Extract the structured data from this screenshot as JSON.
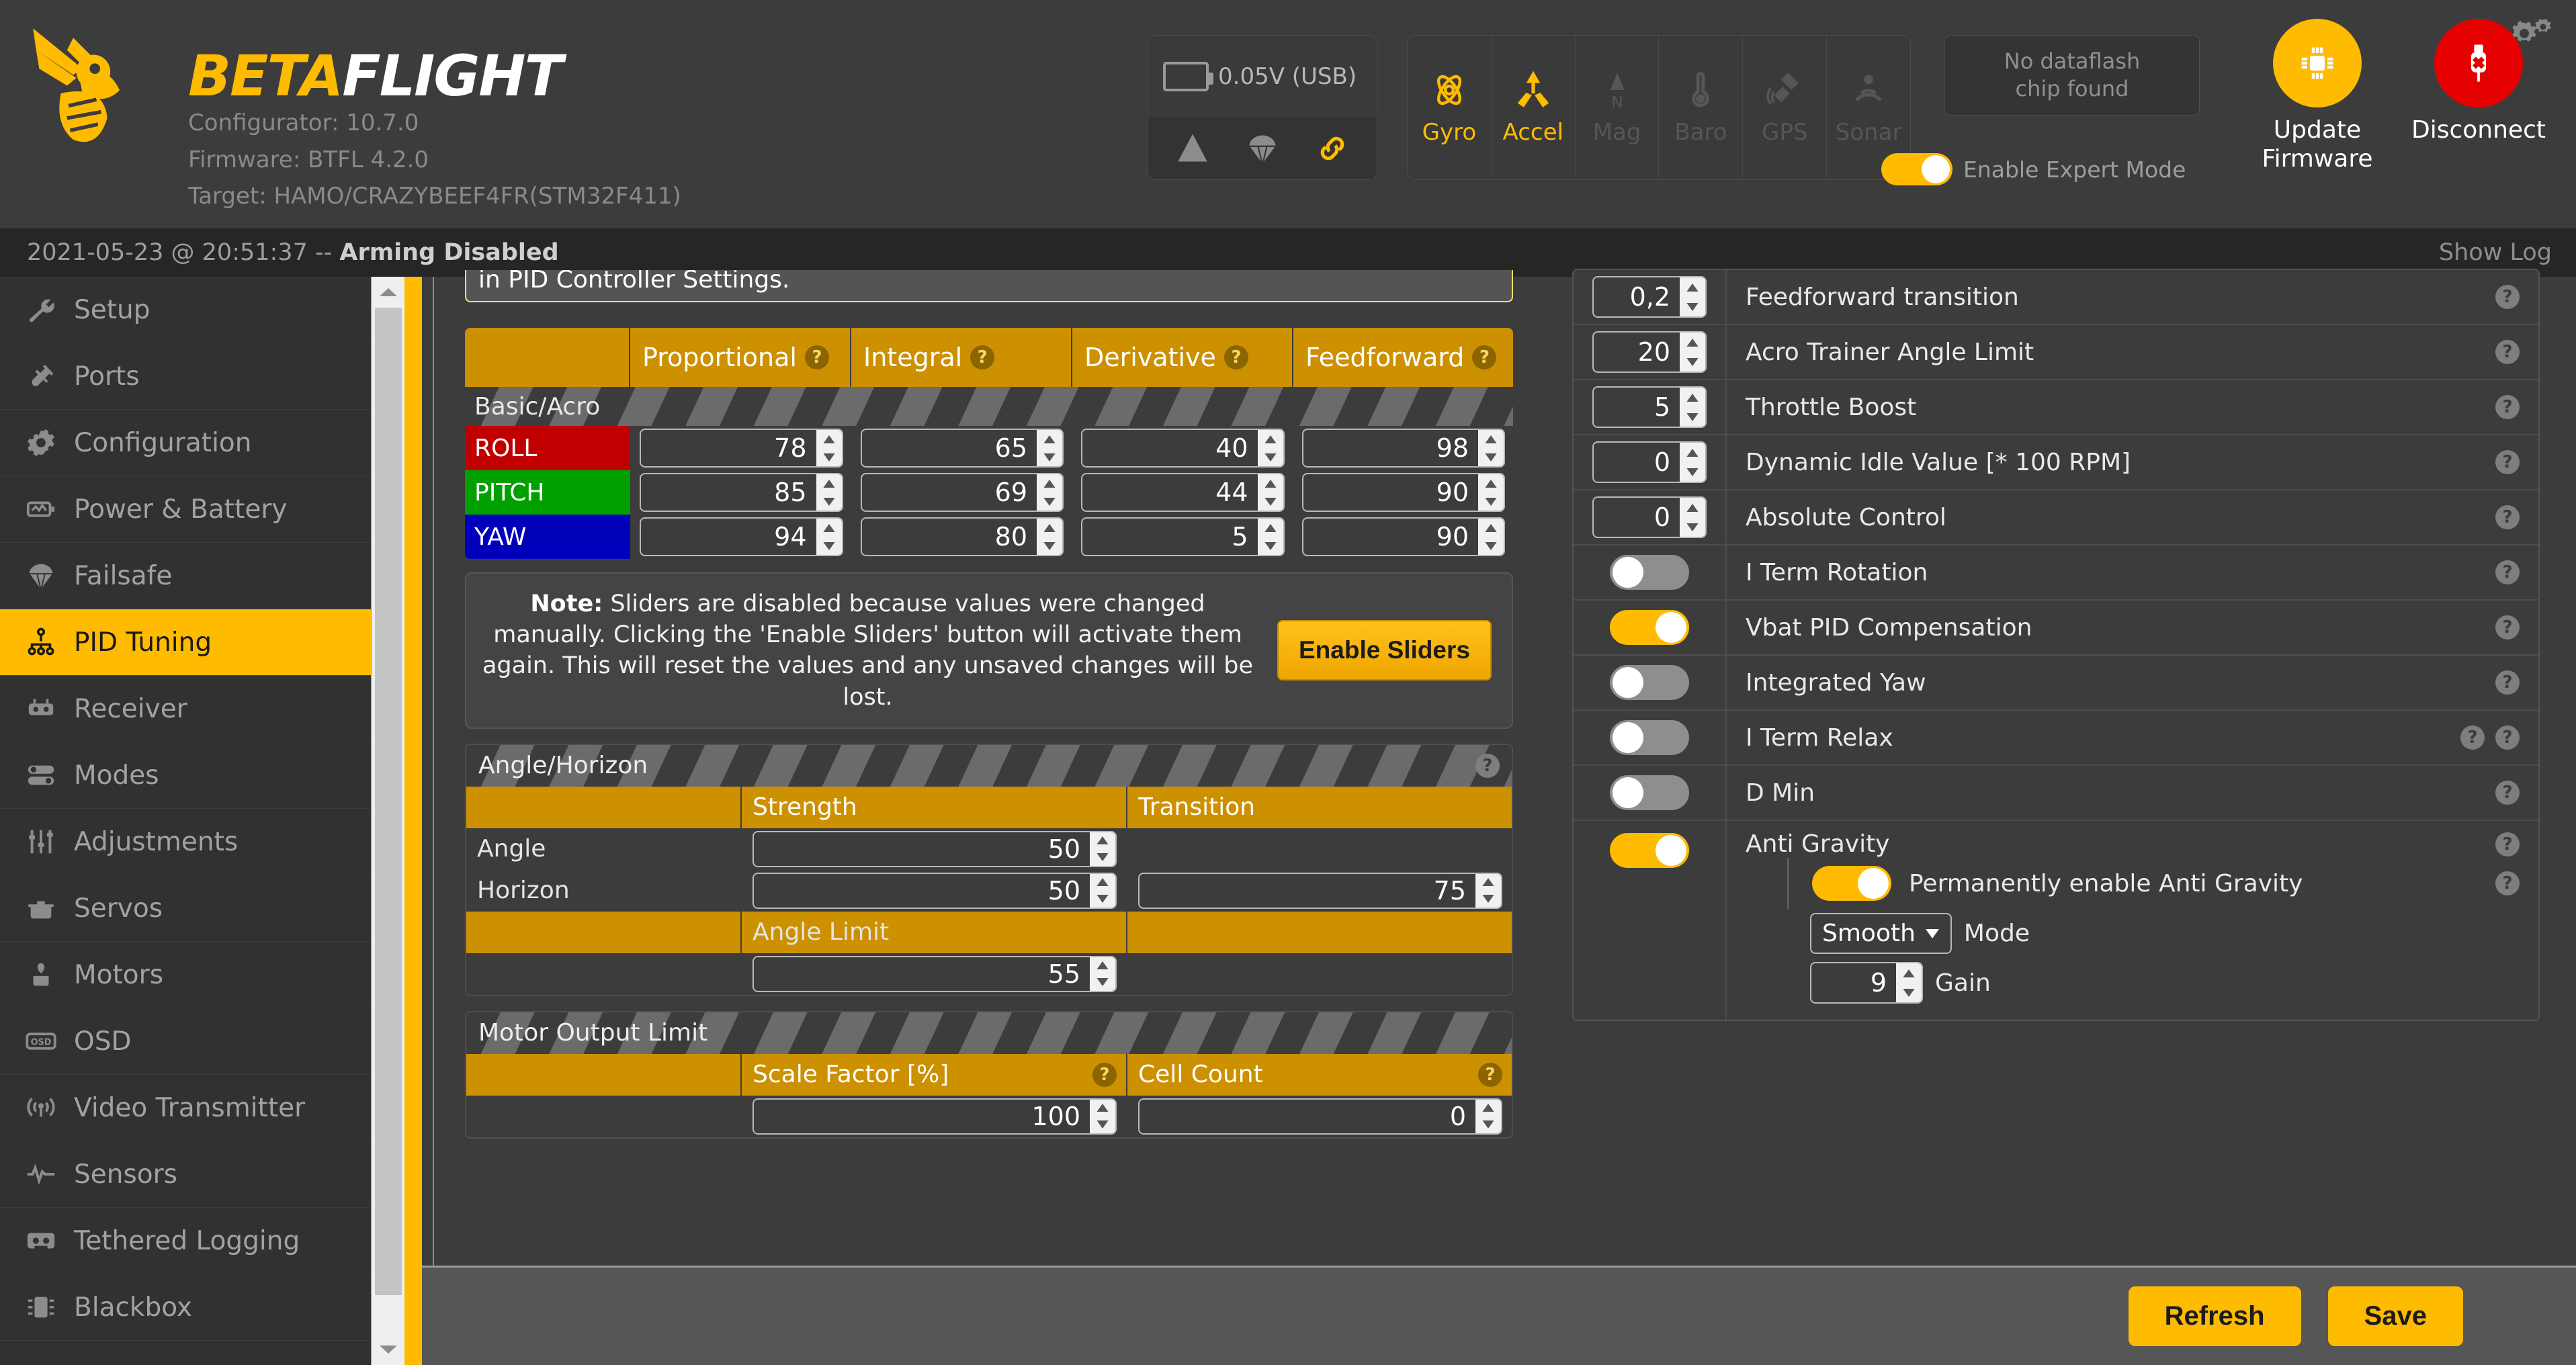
{
  "app": {
    "brand_beta": "BETA",
    "brand_flight": "FLIGHT",
    "configurator_line": "Configurator: 10.7.0",
    "firmware_line": "Firmware: BTFL 4.2.0",
    "target_line": "Target: HAMO/CRAZYBEEF4FR(STM32F411)",
    "accent_color": "#ffbb00",
    "danger_color": "#e60000"
  },
  "header": {
    "battery_voltage": "0.05V (USB)",
    "status_icons": [
      "warning-icon",
      "parachute-icon",
      "link-icon"
    ],
    "sensors": [
      {
        "label": "Gyro",
        "icon": "gyro-icon",
        "active": true
      },
      {
        "label": "Accel",
        "icon": "accel-icon",
        "active": true
      },
      {
        "label": "Mag",
        "icon": "mag-icon",
        "active": false
      },
      {
        "label": "Baro",
        "icon": "baro-icon",
        "active": false
      },
      {
        "label": "GPS",
        "icon": "gps-icon",
        "active": false
      },
      {
        "label": "Sonar",
        "icon": "sonar-icon",
        "active": false
      }
    ],
    "dataflash_text": "No dataflash\nchip found",
    "expert_mode_label": "Enable Expert Mode",
    "expert_mode_on": true,
    "update_firmware_label": "Update\nFirmware",
    "disconnect_label": "Disconnect",
    "settings_icon": "gear-icon"
  },
  "statusbar": {
    "timestamp": "2021-05-23 @ 20:51:37 -- ",
    "state": "Arming Disabled",
    "show_log": "Show Log"
  },
  "sidebar": {
    "items": [
      {
        "label": "Setup",
        "icon": "wrench-icon",
        "active": false
      },
      {
        "label": "Ports",
        "icon": "plug-icon",
        "active": false
      },
      {
        "label": "Configuration",
        "icon": "gear-icon",
        "active": false
      },
      {
        "label": "Power & Battery",
        "icon": "battery-icon",
        "active": false
      },
      {
        "label": "Failsafe",
        "icon": "parachute-icon",
        "active": false
      },
      {
        "label": "PID Tuning",
        "icon": "sitemap-icon",
        "active": true
      },
      {
        "label": "Receiver",
        "icon": "transmitter-icon",
        "active": false
      },
      {
        "label": "Modes",
        "icon": "toggles-icon",
        "active": false
      },
      {
        "label": "Adjustments",
        "icon": "sliders-icon",
        "active": false
      },
      {
        "label": "Servos",
        "icon": "servo-icon",
        "active": false
      },
      {
        "label": "Motors",
        "icon": "motor-icon",
        "active": false
      },
      {
        "label": "OSD",
        "icon": "osd-icon",
        "active": false
      },
      {
        "label": "Video Transmitter",
        "icon": "vtx-icon",
        "active": false
      },
      {
        "label": "Sensors",
        "icon": "pulse-icon",
        "active": false
      },
      {
        "label": "Tethered Logging",
        "icon": "cassette-icon",
        "active": false
      },
      {
        "label": "Blackbox",
        "icon": "blackbox-icon",
        "active": false
      }
    ]
  },
  "main": {
    "clipped_note": "in PID Controller Settings.",
    "pid_table": {
      "columns": [
        "",
        "Proportional",
        "Integral",
        "Derivative",
        "Feedforward"
      ],
      "group_label": "Basic/Acro",
      "rows": [
        {
          "axis": "ROLL",
          "color": "#c00000",
          "values": [
            "78",
            "65",
            "40",
            "98"
          ]
        },
        {
          "axis": "PITCH",
          "color": "#00a000",
          "values": [
            "85",
            "69",
            "44",
            "90"
          ]
        },
        {
          "axis": "YAW",
          "color": "#0000bb",
          "values": [
            "94",
            "80",
            "5",
            "90"
          ]
        }
      ]
    },
    "slider_note": {
      "prefix": "Note:",
      "text": " Sliders are disabled because values were changed manually. Clicking the 'Enable Sliders' button will activate them again. This will reset the values and any unsaved changes will be lost.",
      "button_label": "Enable Sliders"
    },
    "angle_horizon": {
      "title": "Angle/Horizon",
      "col_strength": "Strength",
      "col_transition": "Transition",
      "angle_label": "Angle",
      "angle_strength": "50",
      "horizon_label": "Horizon",
      "horizon_strength": "50",
      "horizon_transition": "75",
      "angle_limit_label": "Angle Limit",
      "angle_limit": "55"
    },
    "motor_output_limit": {
      "title": "Motor Output Limit",
      "col_scale": "Scale Factor [%]",
      "col_cells": "Cell Count",
      "scale_factor": "100",
      "cell_count": "0"
    }
  },
  "right_panel": {
    "numeric_rows": [
      {
        "value": "0,2",
        "label": "Feedforward transition"
      },
      {
        "value": "20",
        "label": "Acro Trainer Angle Limit"
      },
      {
        "value": "5",
        "label": "Throttle Boost"
      },
      {
        "value": "0",
        "label": "Dynamic Idle Value [* 100 RPM]"
      },
      {
        "value": "0",
        "label": "Absolute Control"
      }
    ],
    "toggle_rows": [
      {
        "label": "I Term Rotation",
        "on": false,
        "help_count": 1
      },
      {
        "label": "Vbat PID Compensation",
        "on": true,
        "help_count": 1
      },
      {
        "label": "Integrated Yaw",
        "on": false,
        "help_count": 1
      },
      {
        "label": "I Term Relax",
        "on": false,
        "help_count": 2
      },
      {
        "label": "D Min",
        "on": false,
        "help_count": 1
      }
    ],
    "anti_gravity": {
      "label": "Anti Gravity",
      "on": true,
      "permanent_label": "Permanently enable Anti Gravity",
      "permanent_on": true,
      "mode_value": "Smooth",
      "mode_label": "Mode",
      "gain_value": "9",
      "gain_label": "Gain"
    }
  },
  "footer": {
    "refresh_label": "Refresh",
    "save_label": "Save"
  }
}
